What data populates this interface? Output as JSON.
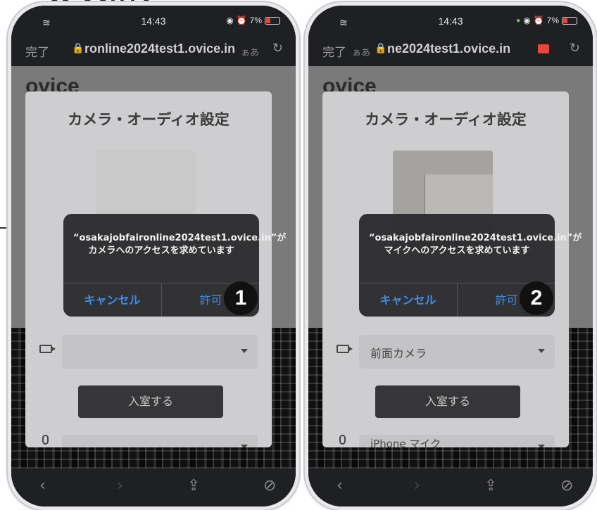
{
  "heading": "ICOの]",
  "phones": [
    {
      "status": {
        "time": "14:43",
        "battery": "7%"
      },
      "url_bar": {
        "done": "完了",
        "aa": "ぁあ",
        "url": "ronline2024test1.ovice.in"
      },
      "logo": "ovice",
      "modal": {
        "title": "カメラ・オーディオ設定",
        "camera_select": "",
        "enter_button": "入室する",
        "mic_select": ""
      },
      "alert": {
        "message": "“osakajobfaironline2024test1.ovice.in”がカメラへのアクセスを求めています",
        "cancel": "キャンセル",
        "allow": "許可"
      },
      "step": "1"
    },
    {
      "status": {
        "time": "14:43",
        "battery": "7%"
      },
      "url_bar": {
        "done": "完了",
        "aa": "ぁあ",
        "url": "ne2024test1.ovice.in"
      },
      "logo": "ovice",
      "modal": {
        "title": "カメラ・オーディオ設定",
        "camera_select": "前面カメラ",
        "enter_button": "入室する",
        "mic_select": "iPhone マイク"
      },
      "alert": {
        "message": "“osakajobfaironline2024test1.ovice.in”がマイクへのアクセスを求めています",
        "cancel": "キャンセル",
        "allow": "許可"
      },
      "step": "2"
    }
  ],
  "icons": [
    "wifi-icon",
    "lock-icon",
    "reload-icon",
    "camera-icon",
    "mic-icon",
    "back-icon",
    "forward-icon",
    "share-icon",
    "compass-icon"
  ],
  "colors": {
    "ios_blue": "#3a8eef",
    "badge": "#111111",
    "camera_indicator": "#e8473b"
  }
}
